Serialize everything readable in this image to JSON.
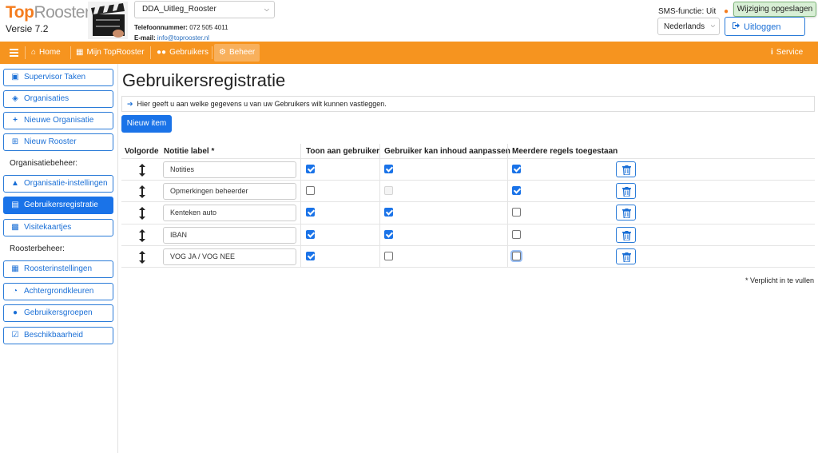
{
  "header": {
    "brand_top": "Top",
    "brand_rooster": "Rooster",
    "version": "Versie 7.2",
    "schedule_selected": "DDA_Uitleg_Rooster",
    "phone_label": "Telefoonnummer:",
    "phone_value": "072 505 4011",
    "email_label": "E-mail:",
    "email_value": "info@toprooster.nl",
    "sms_status": "SMS-functie: Uit",
    "saved_badge": "Wijziging opgeslagen",
    "language_selected": "Nederlands",
    "logout_label": "Uitloggen"
  },
  "nav": {
    "home": "Home",
    "mijn": "Mijn TopRooster",
    "gebruikers": "Gebruikers",
    "beheer": "Beheer",
    "service": "Service"
  },
  "sidebar": {
    "items": [
      {
        "label": "Supervisor Taken",
        "icon": "briefcase-icon"
      },
      {
        "label": "Organisaties",
        "icon": "buildings-icon"
      },
      {
        "label": "Nieuwe Organisatie",
        "icon": "plus-icon"
      },
      {
        "label": "Nieuw Rooster",
        "icon": "calendar-plus-icon"
      },
      {
        "label": "Organisatie-instellingen",
        "icon": "box-icon"
      },
      {
        "label": "Gebruikersregistratie",
        "icon": "list-card-icon"
      },
      {
        "label": "Visitekaartjes",
        "icon": "id-card-icon"
      },
      {
        "label": "Roosterinstellingen",
        "icon": "calendar-icon"
      },
      {
        "label": "Achtergrondkleuren",
        "icon": "pie-chart-icon"
      },
      {
        "label": "Gebruikersgroepen",
        "icon": "users-icon"
      },
      {
        "label": "Beschikbaarheid",
        "icon": "calendar-check-icon"
      }
    ],
    "section_org": "Organisatiebeheer:",
    "section_rooster": "Roosterbeheer:"
  },
  "main": {
    "title": "Gebruikersregistratie",
    "info": "Hier geeft u aan welke gegevens u van uw Gebruikers wilt kunnen vastleggen.",
    "new_button": "Nieuw item",
    "columns": {
      "volgorde": "Volgorde",
      "label": "Notitie label *",
      "toon": "Toon aan gebruiker",
      "aanpassen": "Gebruiker kan inhoud aanpassen",
      "meerdere": "Meerdere regels toegestaan"
    },
    "rows": [
      {
        "label": "Notities",
        "toon": true,
        "aanpassen": true,
        "meerdere": true
      },
      {
        "label": "Opmerkingen beheerder",
        "toon": false,
        "aanpassen": "disabled",
        "meerdere": true
      },
      {
        "label": "Kenteken auto",
        "toon": true,
        "aanpassen": true,
        "meerdere": false
      },
      {
        "label": "IBAN",
        "toon": true,
        "aanpassen": true,
        "meerdere": false
      },
      {
        "label": "VOG JA / VOG NEE",
        "toon": true,
        "aanpassen": false,
        "meerdere": false
      }
    ],
    "footnote": "* Verplicht in te vullen"
  },
  "colors": {
    "nav_orange": "#f6941f",
    "accent_blue": "#1a73e8",
    "saved_green": "#d8efd5"
  }
}
